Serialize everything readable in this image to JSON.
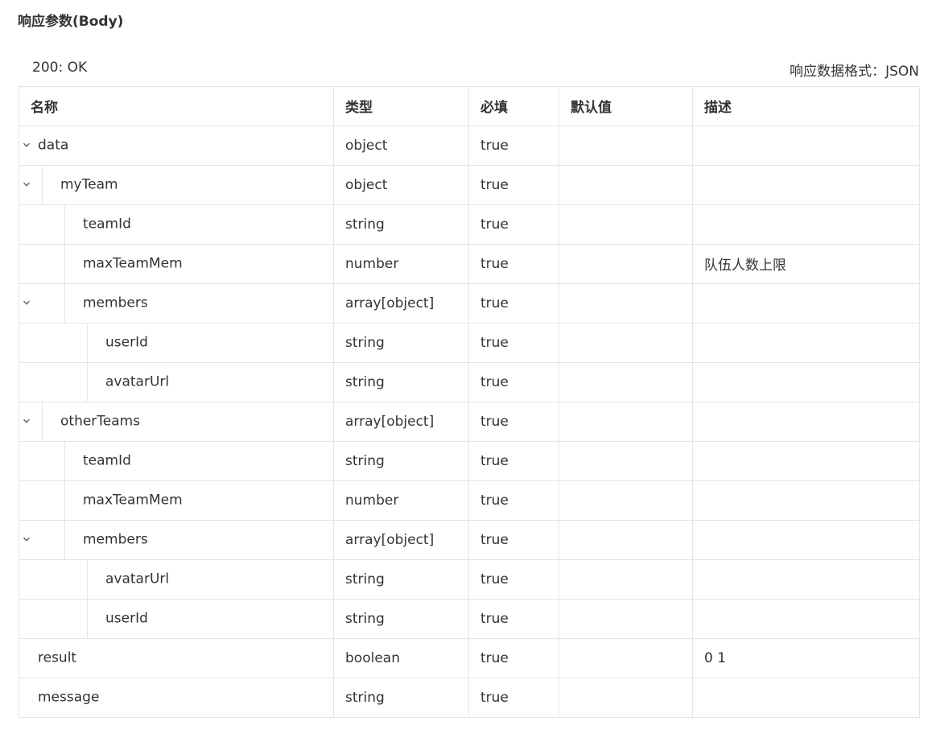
{
  "section_title": "响应参数(Body)",
  "status": "200: OK",
  "format": "响应数据格式：JSON",
  "headers": [
    "名称",
    "类型",
    "必填",
    "默认值",
    "描述"
  ],
  "rows": [
    {
      "name": "data",
      "type": "object",
      "required": "true",
      "default": "",
      "desc": "",
      "level": 0,
      "expandable": true
    },
    {
      "name": "myTeam",
      "type": "object",
      "required": "true",
      "default": "",
      "desc": "",
      "level": 1,
      "expandable": true
    },
    {
      "name": "teamId",
      "type": "string",
      "required": "true",
      "default": "",
      "desc": "",
      "level": 2,
      "expandable": false
    },
    {
      "name": "maxTeamMem",
      "type": "number",
      "required": "true",
      "default": "",
      "desc": "队伍人数上限",
      "level": 2,
      "expandable": false
    },
    {
      "name": "members",
      "type": "array[object]",
      "required": "true",
      "default": "",
      "desc": "",
      "level": 2,
      "expandable": true
    },
    {
      "name": "userId",
      "type": "string",
      "required": "true",
      "default": "",
      "desc": "",
      "level": 3,
      "expandable": false
    },
    {
      "name": "avatarUrl",
      "type": "string",
      "required": "true",
      "default": "",
      "desc": "",
      "level": 3,
      "expandable": false
    },
    {
      "name": "otherTeams",
      "type": "array[object]",
      "required": "true",
      "default": "",
      "desc": "",
      "level": 1,
      "expandable": true
    },
    {
      "name": "teamId",
      "type": "string",
      "required": "true",
      "default": "",
      "desc": "",
      "level": 2,
      "expandable": false
    },
    {
      "name": "maxTeamMem",
      "type": "number",
      "required": "true",
      "default": "",
      "desc": "",
      "level": 2,
      "expandable": false
    },
    {
      "name": "members",
      "type": "array[object]",
      "required": "true",
      "default": "",
      "desc": "",
      "level": 2,
      "expandable": true
    },
    {
      "name": "avatarUrl",
      "type": "string",
      "required": "true",
      "default": "",
      "desc": "",
      "level": 3,
      "expandable": false
    },
    {
      "name": "userId",
      "type": "string",
      "required": "true",
      "default": "",
      "desc": "",
      "level": 3,
      "expandable": false
    },
    {
      "name": "result",
      "type": "boolean",
      "required": "true",
      "default": "",
      "desc": "0 1",
      "level": 0,
      "expandable": false
    },
    {
      "name": "message",
      "type": "string",
      "required": "true",
      "default": "",
      "desc": "",
      "level": 0,
      "expandable": false
    }
  ]
}
